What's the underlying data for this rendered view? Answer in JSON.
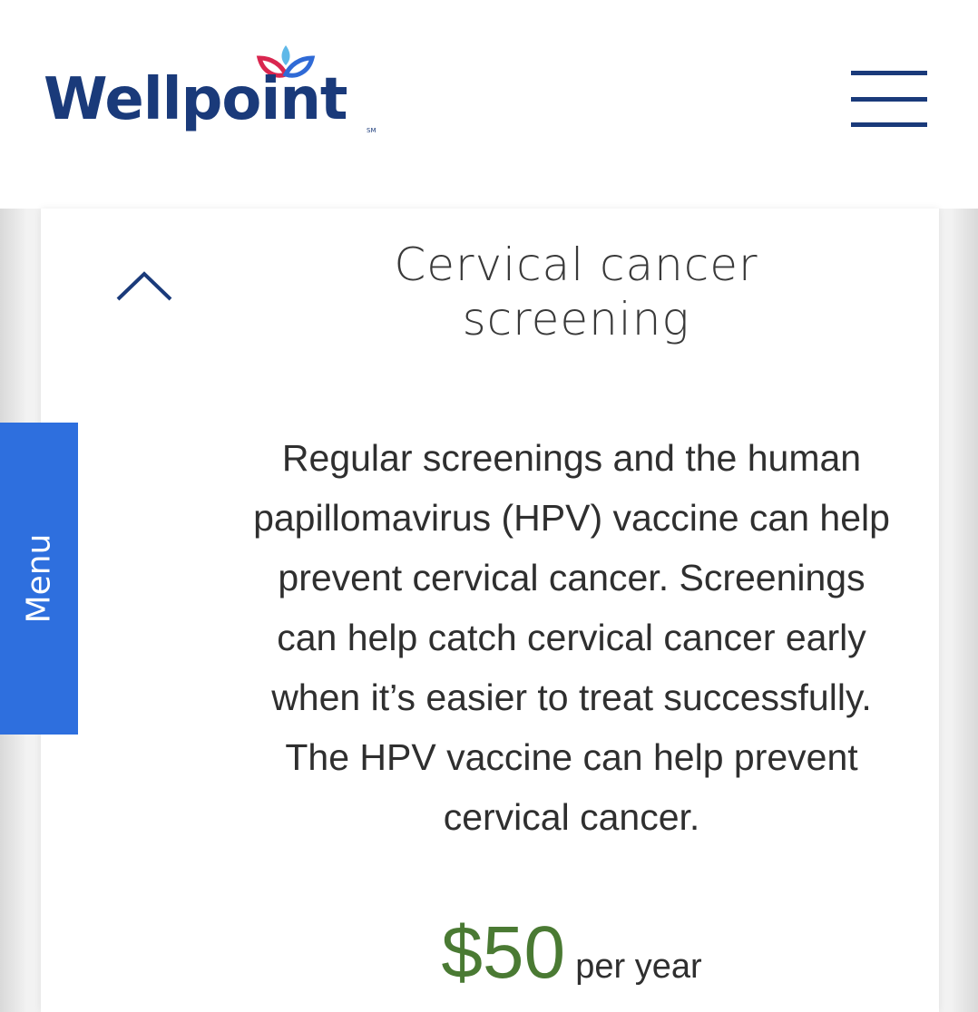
{
  "header": {
    "logo_text": "Wellpoint",
    "logo_mark": "SM",
    "menu_icon": "hamburger-icon"
  },
  "side_menu": {
    "label": "Menu"
  },
  "card": {
    "collapse_icon": "chevron-up-icon",
    "title": "Cervical cancer screening",
    "description": "Regular screenings and the human papillomavirus (HPV) vaccine can help prevent cervical cancer. Screenings can help catch cervical cancer early when it’s easier to treat successfully. The HPV vaccine can help prevent cervical cancer.",
    "price": {
      "amount": "$50",
      "unit": "per year"
    }
  },
  "colors": {
    "brand_navy": "#1a3a7a",
    "menu_blue": "#2e6fde",
    "price_green": "#4a7a33",
    "logo_petal_red": "#d9264f",
    "logo_petal_blue": "#2f6ad6",
    "logo_petal_lightblue": "#5fb8e8"
  }
}
